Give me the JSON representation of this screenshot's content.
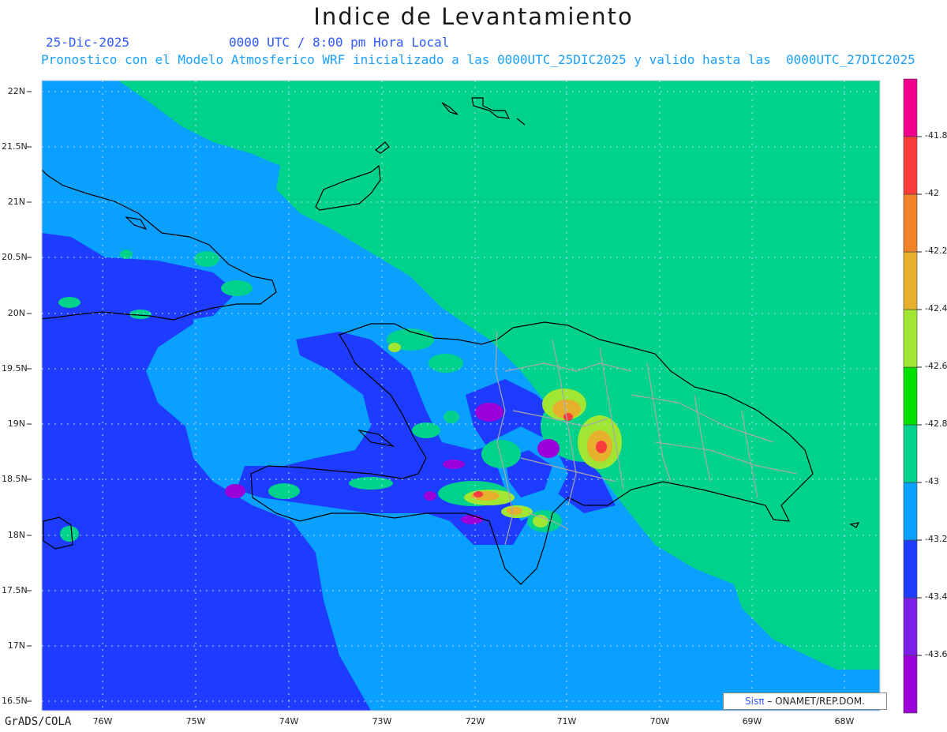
{
  "title": "Indice de Levantamiento",
  "date": "25-Dic-2025",
  "time": "0000 UTC / 8:00 pm Hora Local",
  "description": "Pronostico con el Modelo Atmosferico WRF inicializado a las 0000UTC_25DIC2025 y valido hasta las  0000UTC_27DIC2025",
  "lat_labels": [
    "22N",
    "21.5N",
    "21N",
    "20.5N",
    "20N",
    "19.5N",
    "19N",
    "18.5N",
    "18N",
    "17.5N",
    "17N",
    "16.5N"
  ],
  "lon_labels": [
    "76W",
    "75W",
    "74W",
    "73W",
    "72W",
    "71W",
    "70W",
    "69W",
    "68W"
  ],
  "colorbar": {
    "labels": [
      "-41.8",
      "-42",
      "-42.2",
      "-42.4",
      "-42.6",
      "-42.8",
      "-43",
      "-43.2",
      "-43.4",
      "-43.6"
    ],
    "colors": [
      "#9b00d8",
      "#7a20e8",
      "#1e3cff",
      "#0aa0ff",
      "#00d28c",
      "#00e000",
      "#a0e632",
      "#e6af2d",
      "#f08228",
      "#fa3c3c",
      "#f0008c"
    ]
  },
  "credit": {
    "prefix": "Sis",
    "symbol": "π",
    "suffix": " – ONAMET/REP.DOM."
  },
  "software": "GrADS/COLA",
  "map_colors": {
    "deep_sea": "#1e3cff",
    "sea": "#0aa0ff",
    "green_zone": "#00d28c",
    "purple": "#9b00d8",
    "lime": "#a0e632",
    "orange": "#e6af2d",
    "red": "#fa3c3c"
  }
}
